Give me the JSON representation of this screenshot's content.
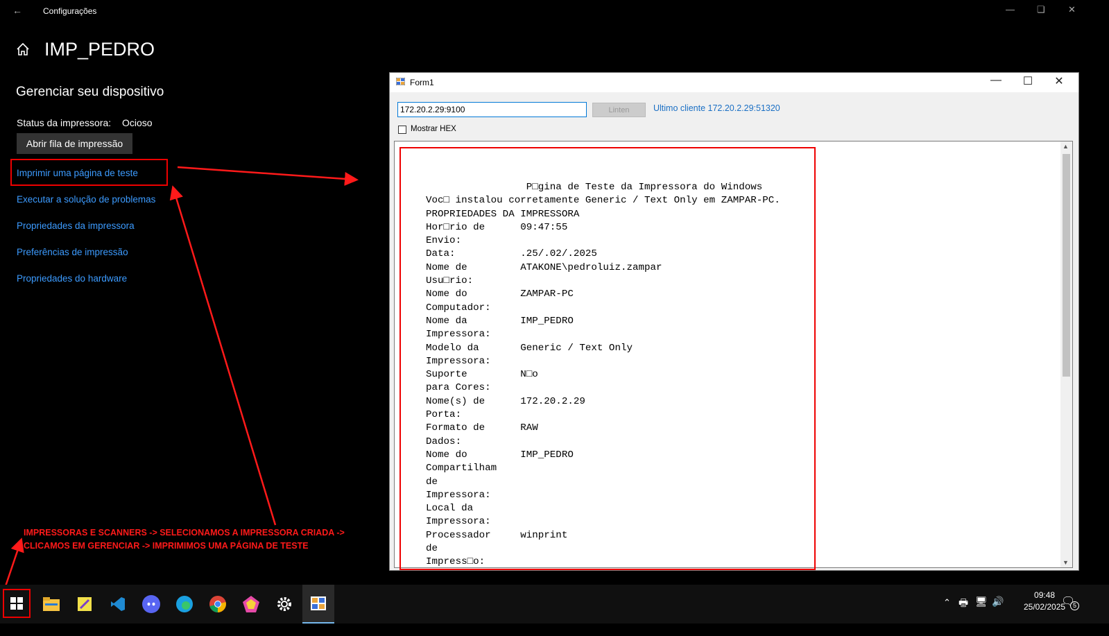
{
  "settings": {
    "window_title": "Configurações",
    "page_title": "IMP_PEDRO",
    "section_title": "Gerenciar seu dispositivo",
    "status_label": "Status da impressora:",
    "status_value": "Ocioso",
    "queue_button": "Abrir fila de impressão",
    "links": [
      "Imprimir uma página de teste",
      "Executar a solução de problemas",
      "Propriedades da impressora",
      "Preferências de impressão",
      "Propriedades do hardware"
    ]
  },
  "form1": {
    "title": "Form1",
    "address_value": "172.20.2.29:9100",
    "listen_button": "Linten",
    "last_client": "Ultimo cliente 172.20.2.29:51320",
    "hex_label": "Mostrar HEX",
    "hex_checked": false,
    "received_text": "                 P□gina de Teste da Impressora do Windows\nVoc□ instalou corretamente Generic / Text Only em ZAMPAR-PC.\nPROPRIEDADES DA IMPRESSORA\nHor□rio de      09:47:55\nEnvio:\nData:           .25/.02/.2025\nNome de         ATAKONE\\pedroluiz.zampar\nUsu□rio:\nNome do         ZAMPAR-PC\nComputador:\nNome da         IMP_PEDRO\nImpressora:\nModelo da       Generic / Text Only\nImpressora:\nSuporte         N□o\npara Cores:\nNome(s) de      172.20.2.29\nPorta:\nFormato de      RAW\nDados:\nNome do         IMP_PEDRO\nCompartilham\nde\nImpressora:\nLocal da\nImpressora:\nProcessador     winprint\nde\nImpress□o:"
  },
  "annotation": {
    "line1": "IMPRESSORAS E SCANNERS -> SELECIONAMOS A IMPRESSORA CRIADA ->",
    "line2": "CLICAMOS EM GERENCIAR -> IMPRIMIMOS UMA PÁGINA DE TESTE"
  },
  "taskbar": {
    "apps": [
      "start-icon",
      "file-explorer-icon",
      "app-icon",
      "vscode-icon",
      "discord-icon",
      "edge-icon",
      "chrome-icon",
      "app-polygon-icon",
      "settings-icon",
      "form1-app-icon"
    ],
    "time": "09:48",
    "date": "25/02/2025",
    "notification_count": "5"
  },
  "colors": {
    "link": "#3c9bff",
    "annotation": "#ff1a1a",
    "last_client": "#1a6fc4"
  }
}
